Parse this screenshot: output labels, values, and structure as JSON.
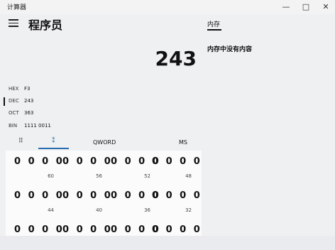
{
  "window": {
    "title": "计算器",
    "minimize": "—",
    "maximize": "□",
    "close": "✕"
  },
  "header": {
    "mode_title": "程序员"
  },
  "display": {
    "value": "243"
  },
  "memory": {
    "tab_label": "内存",
    "empty_message": "内存中没有内容"
  },
  "radix": [
    {
      "label": "HEX",
      "value": "F3"
    },
    {
      "label": "DEC",
      "value": "243"
    },
    {
      "label": "OCT",
      "value": "363"
    },
    {
      "label": "BIN",
      "value": "1111 0011"
    }
  ],
  "tabs": {
    "keypad_icon": "⠿",
    "bits_icon": "⁑",
    "word_size": "QWORD",
    "ms_label": "MS"
  },
  "bits": {
    "row1": [
      "0 0 0 0",
      "0 0 0 0",
      "0 0 0 0",
      "0 0 0 0"
    ],
    "row1_pos": [
      "60",
      "56",
      "52",
      "48"
    ],
    "row2": [
      "0 0 0 0",
      "0 0 0 0",
      "0 0 0 0",
      "0 0 0 0"
    ],
    "row2_pos": [
      "44",
      "40",
      "36",
      "32"
    ],
    "row3": [
      "0 0 0 0",
      "0 0 0 0",
      "0 0 0 0",
      "0 0 0 0"
    ]
  },
  "icons": {
    "menu": "hamburger-icon",
    "keypad": "keypad-icon",
    "bits": "bit-toggle-icon"
  }
}
